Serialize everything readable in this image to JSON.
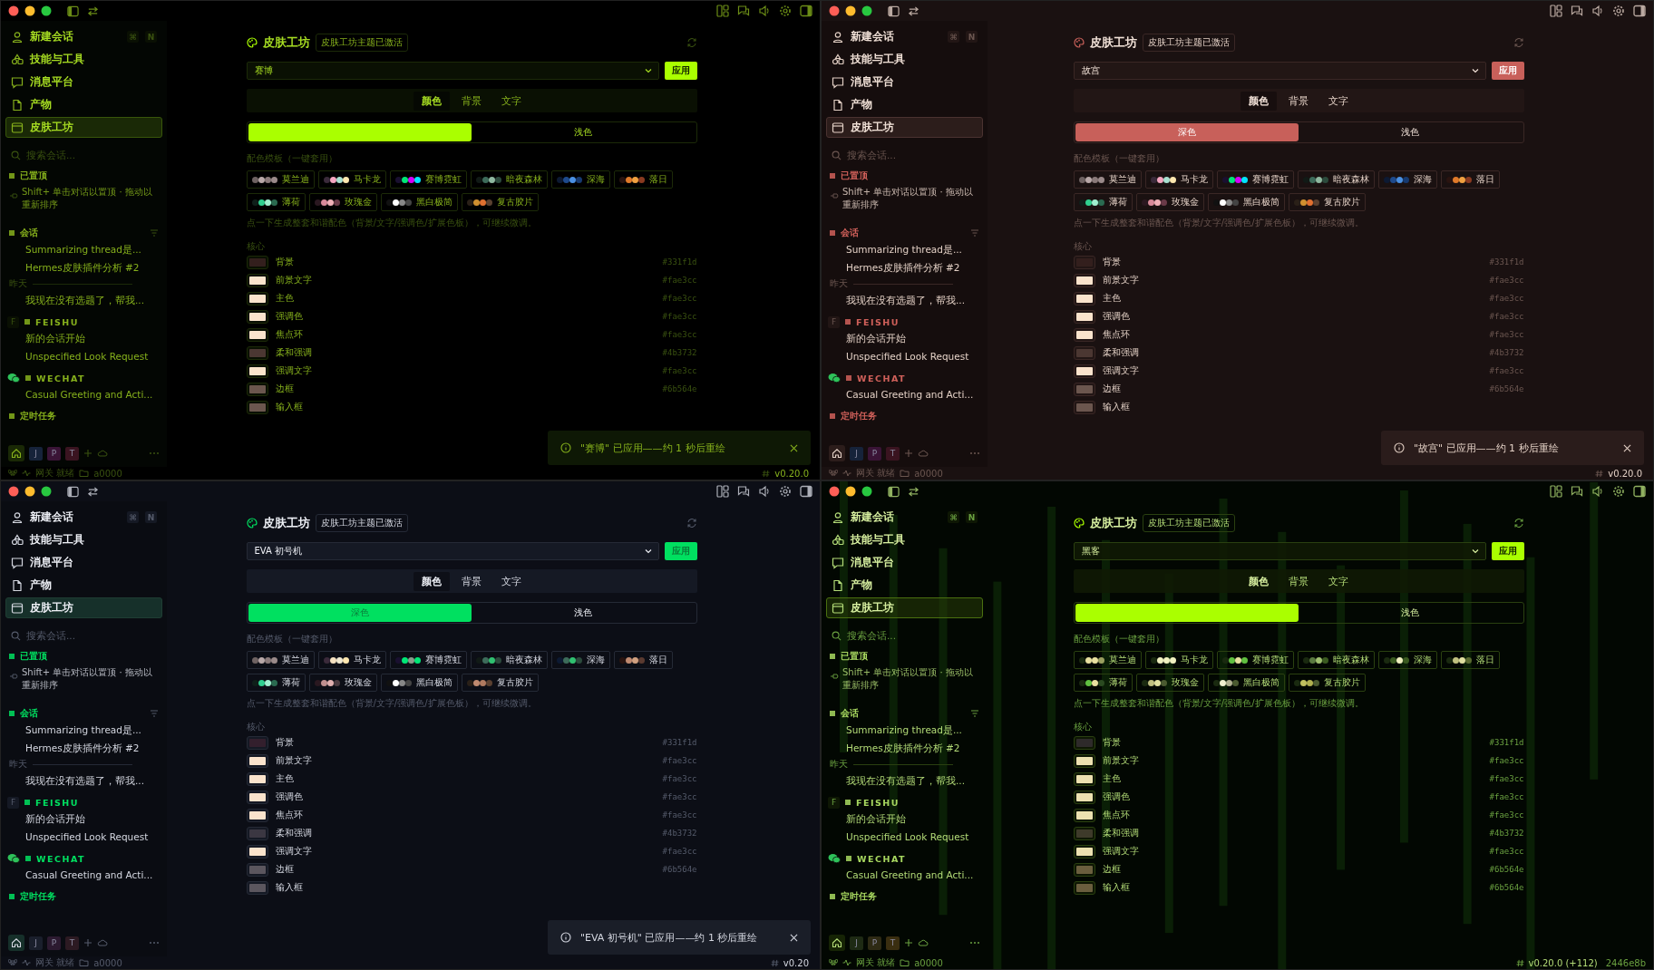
{
  "windows": [
    {
      "kind": "cyber",
      "sidebar": {
        "nav": [
          {
            "label": "新建会话",
            "selected": false,
            "keys": [
              "⌘",
              "N"
            ]
          },
          {
            "label": "技能与工具",
            "selected": false
          },
          {
            "label": "消息平台",
            "selected": false
          },
          {
            "label": "产物",
            "selected": false
          },
          {
            "label": "皮肤工坊",
            "selected": true
          }
        ],
        "search": {
          "placeholder": "搜索会话..."
        },
        "sections": [
          {
            "kind": "pinned",
            "title": "已置顶",
            "hint": "Shift+ 单击对话以置顶 · 拖动以重新排序"
          },
          {
            "kind": "chats",
            "title": "会话",
            "items": [
              "Summarizing thread是...",
              "Hermes皮肤插件分析 #2"
            ],
            "divider": "昨天",
            "older": [
              "我现在没有选题了，帮我..."
            ]
          },
          {
            "kind": "feishu",
            "badge": "F",
            "title": "FEISHU",
            "items": [
              "新的会话开始",
              "Unspecified Look Request"
            ]
          },
          {
            "kind": "wechat",
            "title": "WECHAT",
            "items": [
              "Casual Greeting and Acti..."
            ]
          },
          {
            "kind": "scheduled",
            "title": "定时任务"
          }
        ],
        "workspaces": [
          {
            "label": "J",
            "color": "#16233a"
          },
          {
            "label": "P",
            "color": "#3a1436"
          },
          {
            "label": "T",
            "color": "#3a1420"
          }
        ]
      },
      "main": {
        "title": "皮肤工坊",
        "badge": "皮肤工坊主题已激活",
        "theme_select": {
          "value": "赛博"
        },
        "apply_button": "应用",
        "tabs": [
          {
            "label": "颜色",
            "selected": true
          },
          {
            "label": "背景",
            "selected": false
          },
          {
            "label": "文字",
            "selected": false
          }
        ],
        "modes": [
          {
            "selected": true
          },
          {
            "label": "浅色",
            "selected": false
          }
        ],
        "templates_label": "配色模板（一键套用）",
        "templates": [
          {
            "label": "莫兰迪",
            "dots": [
              {
                "color": "#6e6262"
              },
              {
                "color": "#b8a8a8"
              },
              {
                "color": "#8a7a7a"
              },
              {
                "color": "#9a8a8a"
              }
            ]
          },
          {
            "label": "马卡龙",
            "dots": [
              {
                "color": "#3a2a3a"
              },
              {
                "color": "#f4a6c0"
              },
              {
                "color": "#a8e0d0"
              },
              {
                "color": "#fde7b0"
              }
            ]
          },
          {
            "label": "赛博霓虹",
            "dots": [
              {
                "color": "#1a1030"
              },
              {
                "color": "#00e676"
              },
              {
                "color": "#d500f9"
              },
              {
                "color": "#00e5ff"
              }
            ]
          },
          {
            "label": "暗夜森林",
            "dots": [
              {
                "color": "#111a16"
              },
              {
                "color": "#3d6b5a"
              },
              {
                "color": "#8fb8a0"
              },
              {
                "color": "#2b4a3c"
              }
            ]
          },
          {
            "label": "深海",
            "dots": [
              {
                "color": "#0d1a33"
              },
              {
                "color": "#1e4a8c"
              },
              {
                "color": "#4a90e2"
              },
              {
                "color": "#163a70"
              }
            ]
          },
          {
            "label": "落日",
            "dots": [
              {
                "color": "#2a1410"
              },
              {
                "color": "#e07a2a"
              },
              {
                "color": "#f0a040"
              },
              {
                "color": "#8a3a20"
              }
            ]
          },
          {
            "label": "薄荷",
            "dots": [
              {
                "color": "#0f1f1a"
              },
              {
                "color": "#30d090"
              },
              {
                "color": "#a0f0d0"
              },
              {
                "color": "#2a6a50"
              }
            ]
          },
          {
            "label": "玫瑰金",
            "dots": [
              {
                "color": "#2a1820"
              },
              {
                "color": "#d88a9a"
              },
              {
                "color": "#f0b0b8"
              },
              {
                "color": "#6a3a48"
              }
            ]
          },
          {
            "label": "黑白极简",
            "dots": [
              {
                "color": "#111111"
              },
              {
                "color": "#ffffff"
              },
              {
                "color": "#888888"
              },
              {
                "color": "#444444"
              }
            ]
          },
          {
            "label": "复古胶片",
            "dots": [
              {
                "color": "#2a2018"
              },
              {
                "color": "#d09030"
              },
              {
                "color": "#e07030"
              },
              {
                "color": "#5a4030"
              }
            ]
          }
        ],
        "hint": "点一下生成整套和谐配色（背景/文字/强调色/扩展色板），可继续微调。",
        "group_label": "核心",
        "color_rows": [
          {
            "label": "背景",
            "color": "#331f1d",
            "hex": "#331f1d"
          },
          {
            "label": "前景文字",
            "color": "#fae3cc",
            "hex": "#fae3cc"
          },
          {
            "label": "主色",
            "color": "#fae3cc",
            "hex": "#fae3cc"
          },
          {
            "label": "强调色",
            "color": "#fae3cc",
            "hex": "#fae3cc"
          },
          {
            "label": "焦点环",
            "color": "#fae3cc",
            "hex": "#fae3cc"
          },
          {
            "label": "柔和强调",
            "color": "#4b3732",
            "hex": "#4b3732"
          },
          {
            "label": "强调文字",
            "color": "#fae3cc",
            "hex": "#fae3cc"
          },
          {
            "label": "边框",
            "color": "#6b564e",
            "hex": "#6b564e"
          },
          {
            "label": "输入框",
            "color": "#6b564e"
          }
        ]
      },
      "toast": {
        "message": "\"赛博\" 已应用——约 1 秒后重绘"
      },
      "status_bar": {
        "gateway": "网关 就绪",
        "folder": "a0000",
        "version": "v0.20.0"
      }
    },
    {
      "kind": "palace",
      "sidebar": {
        "nav": [
          {
            "label": "新建会话",
            "selected": false,
            "keys": [
              "⌘",
              "N"
            ]
          },
          {
            "label": "技能与工具",
            "selected": false
          },
          {
            "label": "消息平台",
            "selected": false
          },
          {
            "label": "产物",
            "selected": false
          },
          {
            "label": "皮肤工坊",
            "selected": true
          }
        ],
        "search": {
          "placeholder": "搜索会话..."
        },
        "sections": [
          {
            "kind": "pinned",
            "title": "已置顶",
            "hint": "Shift+ 单击对话以置顶 · 拖动以重新排序"
          },
          {
            "kind": "chats",
            "title": "会话",
            "items": [
              "Summarizing thread是...",
              "Hermes皮肤插件分析 #2"
            ],
            "divider": "昨天",
            "older": [
              "我现在没有选题了，帮我..."
            ]
          },
          {
            "kind": "feishu",
            "badge": "F",
            "title": "FEISHU",
            "items": [
              "新的会话开始",
              "Unspecified Look Request"
            ]
          },
          {
            "kind": "wechat",
            "title": "WECHAT",
            "items": [
              "Casual Greeting and Acti..."
            ]
          },
          {
            "kind": "scheduled",
            "title": "定时任务"
          }
        ],
        "workspaces": [
          {
            "label": "J",
            "color": "#16233a"
          },
          {
            "label": "P",
            "color": "#3a1436"
          },
          {
            "label": "T",
            "color": "#3a1420"
          }
        ]
      },
      "main": {
        "title": "皮肤工坊",
        "badge": "皮肤工坊主题已激活",
        "theme_select": {
          "value": "故宫"
        },
        "apply_button": "应用",
        "tabs": [
          {
            "label": "颜色",
            "selected": true
          },
          {
            "label": "背景",
            "selected": false
          },
          {
            "label": "文字",
            "selected": false
          }
        ],
        "modes": [
          {
            "label": "深色",
            "selected": true
          },
          {
            "label": "浅色",
            "selected": false
          }
        ],
        "templates_label": "配色模板（一键套用）",
        "templates": [
          {
            "label": "莫兰迪",
            "dots": [
              {
                "color": "#6e6262"
              },
              {
                "color": "#b8a8a8"
              },
              {
                "color": "#8a7a7a"
              },
              {
                "color": "#9a8a8a"
              }
            ]
          },
          {
            "label": "马卡龙",
            "dots": [
              {
                "color": "#3a2a3a"
              },
              {
                "color": "#f4a6c0"
              },
              {
                "color": "#a8e0d0"
              },
              {
                "color": "#fde7b0"
              }
            ]
          },
          {
            "label": "赛博霓虹",
            "dots": [
              {
                "color": "#1a1030"
              },
              {
                "color": "#00e676"
              },
              {
                "color": "#d500f9"
              },
              {
                "color": "#00e5ff"
              }
            ]
          },
          {
            "label": "暗夜森林",
            "dots": [
              {
                "color": "#111a16"
              },
              {
                "color": "#3d6b5a"
              },
              {
                "color": "#8fb8a0"
              },
              {
                "color": "#2b4a3c"
              }
            ]
          },
          {
            "label": "深海",
            "dots": [
              {
                "color": "#0d1a33"
              },
              {
                "color": "#1e4a8c"
              },
              {
                "color": "#4a90e2"
              },
              {
                "color": "#163a70"
              }
            ]
          },
          {
            "label": "落日",
            "dots": [
              {
                "color": "#2a1410"
              },
              {
                "color": "#e07a2a"
              },
              {
                "color": "#f0a040"
              },
              {
                "color": "#8a3a20"
              }
            ]
          },
          {
            "label": "薄荷",
            "dots": [
              {
                "color": "#0f1f1a"
              },
              {
                "color": "#30d090"
              },
              {
                "color": "#a0f0d0"
              },
              {
                "color": "#2a6a50"
              }
            ]
          },
          {
            "label": "玫瑰金",
            "dots": [
              {
                "color": "#2a1820"
              },
              {
                "color": "#d88a9a"
              },
              {
                "color": "#f0b0b8"
              },
              {
                "color": "#6a3a48"
              }
            ]
          },
          {
            "label": "黑白极简",
            "dots": [
              {
                "color": "#111111"
              },
              {
                "color": "#ffffff"
              },
              {
                "color": "#888888"
              },
              {
                "color": "#444444"
              }
            ]
          },
          {
            "label": "复古胶片",
            "dots": [
              {
                "color": "#2a2018"
              },
              {
                "color": "#d09030"
              },
              {
                "color": "#e07030"
              },
              {
                "color": "#5a4030"
              }
            ]
          }
        ],
        "hint": "点一下生成整套和谐配色（背景/文字/强调色/扩展色板），可继续微调。",
        "group_label": "核心",
        "color_rows": [
          {
            "label": "背景",
            "color": "#331f1d",
            "hex": "#331f1d"
          },
          {
            "label": "前景文字",
            "color": "#fae3cc",
            "hex": "#fae3cc"
          },
          {
            "label": "主色",
            "color": "#fae3cc",
            "hex": "#fae3cc"
          },
          {
            "label": "强调色",
            "color": "#fae3cc",
            "hex": "#fae3cc"
          },
          {
            "label": "焦点环",
            "color": "#fae3cc",
            "hex": "#fae3cc"
          },
          {
            "label": "柔和强调",
            "color": "#4b3732",
            "hex": "#4b3732"
          },
          {
            "label": "强调文字",
            "color": "#fae3cc",
            "hex": "#fae3cc"
          },
          {
            "label": "边框",
            "color": "#6b564e",
            "hex": "#6b564e"
          },
          {
            "label": "输入框",
            "color": "#6b564e"
          }
        ]
      },
      "toast": {
        "message": "\"故宫\" 已应用——约 1 秒后重绘"
      },
      "status_bar": {
        "gateway": "网关 就绪",
        "folder": "a0000",
        "version": "v0.20.0"
      }
    },
    {
      "kind": "eva",
      "sidebar": {
        "nav": [
          {
            "label": "新建会话",
            "selected": false,
            "keys": [
              "⌘",
              "N"
            ]
          },
          {
            "label": "技能与工具",
            "selected": false
          },
          {
            "label": "消息平台",
            "selected": false
          },
          {
            "label": "产物",
            "selected": false
          },
          {
            "label": "皮肤工坊",
            "selected": true
          }
        ],
        "search": {
          "placeholder": "搜索会话..."
        },
        "sections": [
          {
            "kind": "pinned",
            "title": "已置顶",
            "hint": "Shift+ 单击对话以置顶 · 拖动以重新排序"
          },
          {
            "kind": "chats",
            "title": "会话",
            "items": [
              "Summarizing thread是...",
              "Hermes皮肤插件分析 #2"
            ],
            "divider": "昨天",
            "older": [
              "我现在没有选题了，帮我..."
            ]
          },
          {
            "kind": "feishu",
            "badge": "F",
            "title": "FEISHU",
            "items": [
              "新的会话开始",
              "Unspecified Look Request"
            ]
          },
          {
            "kind": "wechat",
            "title": "WECHAT",
            "items": [
              "Casual Greeting and Acti..."
            ]
          },
          {
            "kind": "scheduled",
            "title": "定时任务"
          }
        ],
        "workspaces": [
          {
            "label": "J",
            "color": "#1a1f2c"
          },
          {
            "label": "P",
            "color": "#2c1a30"
          },
          {
            "label": "T",
            "color": "#2c1a22"
          }
        ]
      },
      "main": {
        "title": "皮肤工坊",
        "badge": "皮肤工坊主题已激活",
        "theme_select": {
          "value": "EVA 初号机"
        },
        "apply_button": "应用",
        "tabs": [
          {
            "label": "颜色",
            "selected": true
          },
          {
            "label": "背景",
            "selected": false
          },
          {
            "label": "文字",
            "selected": false
          }
        ],
        "modes": [
          {
            "label": "深色",
            "selected": true
          },
          {
            "label": "浅色",
            "selected": false
          }
        ],
        "templates_label": "配色模板（一键套用）",
        "templates": [
          {
            "label": "莫兰迪",
            "dots": [
              {
                "color": "#6e6262"
              },
              {
                "color": "#b8a8a8"
              },
              {
                "color": "#8a7a7a"
              },
              {
                "color": "#9a8a8a"
              }
            ]
          },
          {
            "label": "马卡龙",
            "dots": [
              {
                "color": "#3a2a3a"
              },
              {
                "color": "#f4e0c0"
              },
              {
                "color": "#f0e8d0"
              },
              {
                "color": "#fde7b0"
              }
            ]
          },
          {
            "label": "赛博霓虹",
            "dots": [
              {
                "color": "#1a1030"
              },
              {
                "color": "#00e676"
              },
              {
                "color": "#8a9a8a"
              },
              {
                "color": "#00e676"
              }
            ]
          },
          {
            "label": "暗夜森林",
            "dots": [
              {
                "color": "#111a16"
              },
              {
                "color": "#3d6b5a"
              },
              {
                "color": "#30c070"
              },
              {
                "color": "#2b4a3c"
              }
            ]
          },
          {
            "label": "深海",
            "dots": [
              {
                "color": "#0d1a33"
              },
              {
                "color": "#3d6b5a"
              },
              {
                "color": "#30c070"
              },
              {
                "color": "#2b4a3c"
              }
            ]
          },
          {
            "label": "落日",
            "dots": [
              {
                "color": "#2a1410"
              },
              {
                "color": "#c08a70"
              },
              {
                "color": "#d0a080"
              },
              {
                "color": "#5a3a30"
              }
            ]
          },
          {
            "label": "薄荷",
            "dots": [
              {
                "color": "#0f1f1a"
              },
              {
                "color": "#30d090"
              },
              {
                "color": "#a0f0d0"
              },
              {
                "color": "#2a6a50"
              }
            ]
          },
          {
            "label": "玫瑰金",
            "dots": [
              {
                "color": "#2a1820"
              },
              {
                "color": "#c09090"
              },
              {
                "color": "#e0b0b0"
              },
              {
                "color": "#4a3a40"
              }
            ]
          },
          {
            "label": "黑白极简",
            "dots": [
              {
                "color": "#111111"
              },
              {
                "color": "#ffffff"
              },
              {
                "color": "#888888"
              },
              {
                "color": "#444444"
              }
            ]
          },
          {
            "label": "复古胶片",
            "dots": [
              {
                "color": "#2a2018"
              },
              {
                "color": "#c08a70"
              },
              {
                "color": "#b07a60"
              },
              {
                "color": "#5a4030"
              }
            ]
          }
        ],
        "hint": "点一下生成整套和谐配色（背景/文字/强调色/扩展色板），可继续微调。",
        "group_label": "核心",
        "color_rows": [
          {
            "label": "背景",
            "color": "#331f2d",
            "hex": "#331f1d"
          },
          {
            "label": "前景文字",
            "color": "#fae3cc",
            "hex": "#fae3cc"
          },
          {
            "label": "主色",
            "color": "#fae3cc",
            "hex": "#fae3cc"
          },
          {
            "label": "强调色",
            "color": "#fae3cc",
            "hex": "#fae3cc"
          },
          {
            "label": "焦点环",
            "color": "#fae3cc",
            "hex": "#fae3cc"
          },
          {
            "label": "柔和强调",
            "color": "#3b3742",
            "hex": "#4b3732"
          },
          {
            "label": "强调文字",
            "color": "#fae3cc",
            "hex": "#fae3cc"
          },
          {
            "label": "边框",
            "color": "#5b565e",
            "hex": "#6b564e"
          },
          {
            "label": "输入框",
            "color": "#5b565e"
          }
        ]
      },
      "toast": {
        "message": "\"EVA 初号机\" 已应用——约 1 秒后重绘"
      },
      "status_bar": {
        "gateway": "网关 就绪",
        "folder": "a0000",
        "version": "v0.20"
      }
    },
    {
      "kind": "hacker",
      "sidebar": {
        "nav": [
          {
            "label": "新建会话",
            "selected": false,
            "keys": [
              "⌘",
              "N"
            ]
          },
          {
            "label": "技能与工具",
            "selected": false
          },
          {
            "label": "消息平台",
            "selected": false
          },
          {
            "label": "产物",
            "selected": false
          },
          {
            "label": "皮肤工坊",
            "selected": true
          }
        ],
        "search": {
          "placeholder": "搜索会话..."
        },
        "sections": [
          {
            "kind": "pinned",
            "title": "已置顶",
            "hint": "Shift+ 单击对话以置顶 · 拖动以重新排序"
          },
          {
            "kind": "chats",
            "title": "会话",
            "items": [
              "Summarizing thread是...",
              "Hermes皮肤插件分析 #2"
            ],
            "divider": "昨天",
            "older": [
              "我现在没有选题了，帮我..."
            ]
          },
          {
            "kind": "feishu",
            "badge": "F",
            "title": "FEISHU",
            "items": [
              "新的会话开始",
              "Unspecified Look Request"
            ]
          },
          {
            "kind": "wechat",
            "title": "WECHAT",
            "items": [
              "Casual Greeting and Acti..."
            ]
          },
          {
            "kind": "scheduled",
            "title": "定时任务"
          }
        ],
        "workspaces": [
          {
            "label": "J",
            "color": "#1e2a14"
          },
          {
            "label": "P",
            "color": "#2e2a14"
          },
          {
            "label": "T",
            "color": "#3a2e10"
          }
        ]
      },
      "main": {
        "title": "皮肤工坊",
        "badge": "皮肤工坊主题已激活",
        "theme_select": {
          "value": "黑客"
        },
        "apply_button": "应用",
        "tabs": [
          {
            "label": "颜色",
            "selected": true
          },
          {
            "label": "背景",
            "selected": false
          },
          {
            "label": "文字",
            "selected": false
          }
        ],
        "modes": [
          {
            "selected": true
          },
          {
            "label": "浅色",
            "selected": false
          }
        ],
        "templates_label": "配色模板（一键套用）",
        "templates": [
          {
            "label": "莫兰迪",
            "dots": [
              {
                "color": "#1a2a10"
              },
              {
                "color": "#e8e0a0"
              },
              {
                "color": "#e8e0a0"
              },
              {
                "color": "#9aa060"
              }
            ]
          },
          {
            "label": "马卡龙",
            "dots": [
              {
                "color": "#1a2a10"
              },
              {
                "color": "#f0f0c0"
              },
              {
                "color": "#f0f0c0"
              },
              {
                "color": "#f0f0c0"
              }
            ]
          },
          {
            "label": "赛博霓虹",
            "dots": [
              {
                "color": "#1a2a10"
              },
              {
                "color": "#60c040"
              },
              {
                "color": "#e8e0a0"
              },
              {
                "color": "#60c040"
              }
            ]
          },
          {
            "label": "暗夜森林",
            "dots": [
              {
                "color": "#1a2a10"
              },
              {
                "color": "#5a7a40"
              },
              {
                "color": "#a0c070"
              },
              {
                "color": "#3a5a20"
              }
            ]
          },
          {
            "label": "深海",
            "dots": [
              {
                "color": "#1a2a10"
              },
              {
                "color": "#3a5a20"
              },
              {
                "color": "#f0f0c0"
              },
              {
                "color": "#3a5a20"
              }
            ]
          },
          {
            "label": "落日",
            "dots": [
              {
                "color": "#1a2a10"
              },
              {
                "color": "#c0c080"
              },
              {
                "color": "#e0e0a0"
              },
              {
                "color": "#5a6a30"
              }
            ]
          },
          {
            "label": "薄荷",
            "dots": [
              {
                "color": "#1a2a10"
              },
              {
                "color": "#60c040"
              },
              {
                "color": "#e8e0a0"
              },
              {
                "color": "#2a4a20"
              }
            ]
          },
          {
            "label": "玫瑰金",
            "dots": [
              {
                "color": "#1a2a10"
              },
              {
                "color": "#c0c080"
              },
              {
                "color": "#e0e0a0"
              },
              {
                "color": "#4a5a30"
              }
            ]
          },
          {
            "label": "黑白极简",
            "dots": [
              {
                "color": "#1a2a10"
              },
              {
                "color": "#f0f0d0"
              },
              {
                "color": "#b0b090"
              },
              {
                "color": "#4a5a30"
              }
            ]
          },
          {
            "label": "复古胶片",
            "dots": [
              {
                "color": "#1a2a10"
              },
              {
                "color": "#c0c060"
              },
              {
                "color": "#b0b050"
              },
              {
                "color": "#4a5a30"
              }
            ]
          }
        ],
        "hint": "点一下生成整套和谐配色（背景/文字/强调色/扩展色板），可继续微调。",
        "group_label": "核心",
        "color_rows": [
          {
            "label": "背景",
            "color": "#2e2a2a",
            "hex": "#331f1d"
          },
          {
            "label": "前景文字",
            "color": "#ece0b0",
            "hex": "#fae3cc"
          },
          {
            "label": "主色",
            "color": "#ece0b0",
            "hex": "#fae3cc"
          },
          {
            "label": "强调色",
            "color": "#ece0b0",
            "hex": "#fae3cc"
          },
          {
            "label": "焦点环",
            "color": "#ece0b0",
            "hex": "#fae3cc"
          },
          {
            "label": "柔和强调",
            "color": "#3e3a2a",
            "hex": "#4b3732"
          },
          {
            "label": "强调文字",
            "color": "#ece0b0",
            "hex": "#fae3cc"
          },
          {
            "label": "边框",
            "color": "#6a5e3e",
            "hex": "#6b564e"
          },
          {
            "label": "输入框",
            "color": "#6a5e3e",
            "hex": "#6b564e"
          }
        ]
      },
      "status_bar": {
        "gateway": "网关 就绪",
        "folder": "a0000",
        "version": "v0.20.0 (+112)",
        "build": "2446e8b"
      }
    }
  ]
}
